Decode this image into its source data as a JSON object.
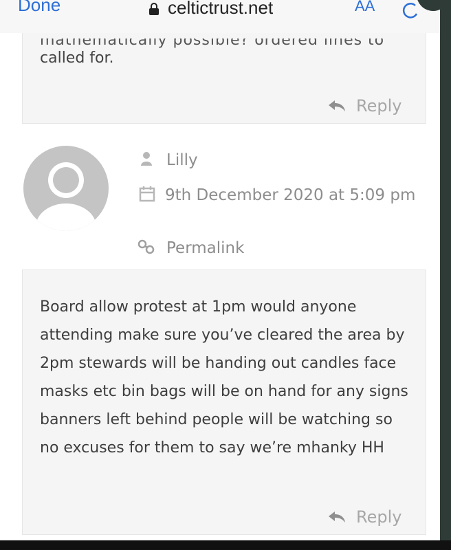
{
  "browser": {
    "done_label": "Done",
    "url": "celtictrust.net",
    "text_size_label": "AA"
  },
  "previous_comment": {
    "cut_text": "mathematically possible? ordered lines to",
    "text": "called for.",
    "reply_label": "Reply"
  },
  "comment": {
    "author": "Lilly",
    "date": "9th December 2020 at 5:09 pm",
    "permalink_label": "Permalink",
    "body": "Board allow protest at 1pm would anyone attending make sure you’ve cleared the area by 2pm stewards will be handing out candles face masks etc bin bags will be on hand for any signs banners left behind people will be watching so no excuses for them to say we’re mhanky HH",
    "reply_label": "Reply"
  },
  "colors": {
    "accent": "#2c6fd6",
    "muted_text": "#8d8d8d",
    "box_bg": "#f5f5f5"
  },
  "icons": [
    "lock-icon",
    "reload-icon",
    "reply-arrow-icon",
    "user-icon",
    "calendar-icon",
    "link-icon",
    "avatar-placeholder"
  ]
}
